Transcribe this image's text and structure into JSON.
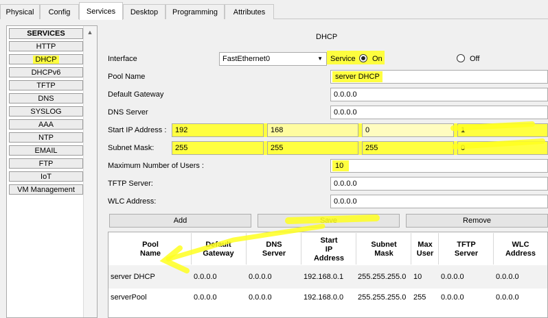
{
  "tabs": [
    "Physical",
    "Config",
    "Services",
    "Desktop",
    "Programming",
    "Attributes"
  ],
  "active_tab": "Services",
  "services": {
    "header": "SERVICES",
    "items": [
      "HTTP",
      "DHCP",
      "DHCPv6",
      "TFTP",
      "DNS",
      "SYSLOG",
      "AAA",
      "NTP",
      "EMAIL",
      "FTP",
      "IoT",
      "VM Management"
    ],
    "selected": "DHCP"
  },
  "panel": {
    "title": "DHCP",
    "interface_label": "Interface",
    "interface_value": "FastEthernet0",
    "service_label": "Service",
    "on_label": "On",
    "off_label": "Off",
    "pool_name_label": "Pool Name",
    "pool_name_value": "server DHCP",
    "default_gateway_label": "Default Gateway",
    "default_gateway_value": "0.0.0.0",
    "dns_server_label": "DNS Server",
    "dns_server_value": "0.0.0.0",
    "start_ip_label": "Start IP Address :",
    "start_ip": [
      "192",
      "168",
      "0",
      "1"
    ],
    "subnet_label": "Subnet Mask:",
    "subnet": [
      "255",
      "255",
      "255",
      "0"
    ],
    "max_users_label": "Maximum Number of Users :",
    "max_users_value": "10",
    "tftp_label": "TFTP Server:",
    "tftp_value": "0.0.0.0",
    "wlc_label": "WLC Address:",
    "wlc_value": "0.0.0.0",
    "add_label": "Add",
    "save_label": "Save",
    "remove_label": "Remove"
  },
  "table": {
    "headers": [
      "Pool Name",
      "Default Gateway",
      "DNS Server",
      "Start IP Address",
      "Subnet Mask",
      "Max User",
      "TFTP Server",
      "WLC Address"
    ],
    "rows": [
      [
        "server DHCP",
        "0.0.0.0",
        "0.0.0.0",
        "192.168.0.1",
        "255.255.255.0",
        "10",
        "0.0.0.0",
        "0.0.0.0"
      ],
      [
        "serverPool",
        "0.0.0.0",
        "0.0.0.0",
        "192.168.0.0",
        "255.255.255.0",
        "255",
        "0.0.0.0",
        "0.0.0.0"
      ]
    ]
  },
  "colors": {
    "highlight": "#ffff40"
  }
}
